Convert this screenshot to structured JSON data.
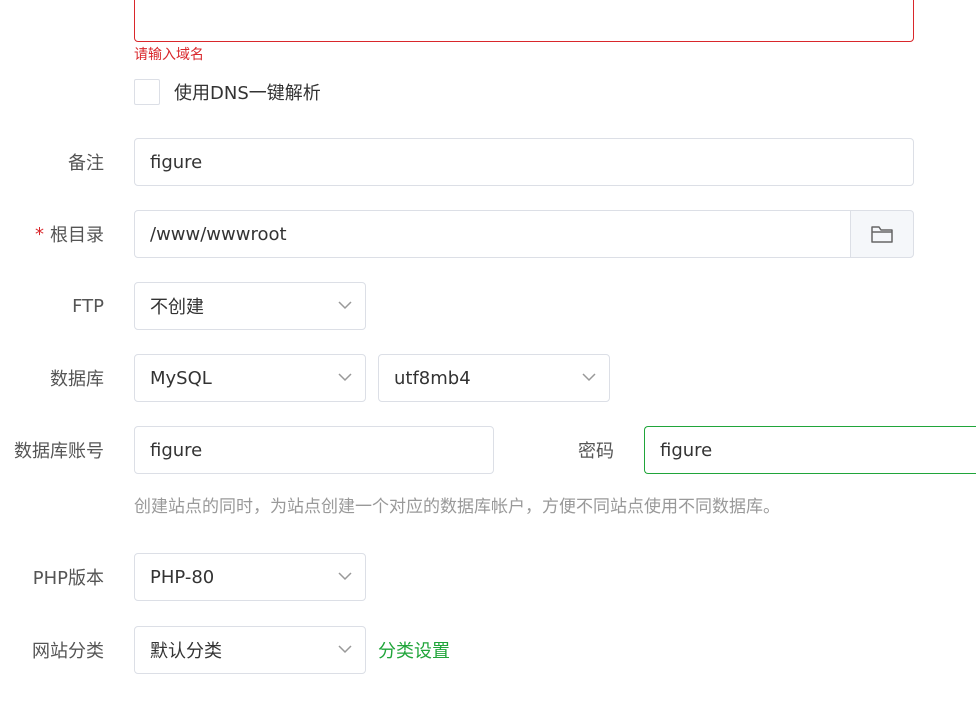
{
  "domain_field": {
    "value": "",
    "error": "请输入域名",
    "dns_checkbox_label": "使用DNS一键解析"
  },
  "remark": {
    "label": "备注",
    "value": "figure"
  },
  "root_dir": {
    "required_mark": "*",
    "label": "根目录",
    "value": "/www/wwwroot",
    "button_icon": "folder-icon"
  },
  "ftp": {
    "label": "FTP",
    "selected": "不创建"
  },
  "database": {
    "label": "数据库",
    "type_selected": "MySQL",
    "charset_selected": "utf8mb4"
  },
  "db_account": {
    "label": "数据库账号",
    "value": "figure",
    "password_label": "密码",
    "password_value": "figure",
    "hint": "创建站点的同时，为站点创建一个对应的数据库帐户，方便不同站点使用不同数据库。"
  },
  "php": {
    "label": "PHP版本",
    "selected": "PHP-80"
  },
  "site_category": {
    "label": "网站分类",
    "selected": "默认分类",
    "settings_link": "分类设置"
  },
  "colors": {
    "error": "#d9272b",
    "accent": "#20a53a",
    "border": "#dcdfe6"
  }
}
